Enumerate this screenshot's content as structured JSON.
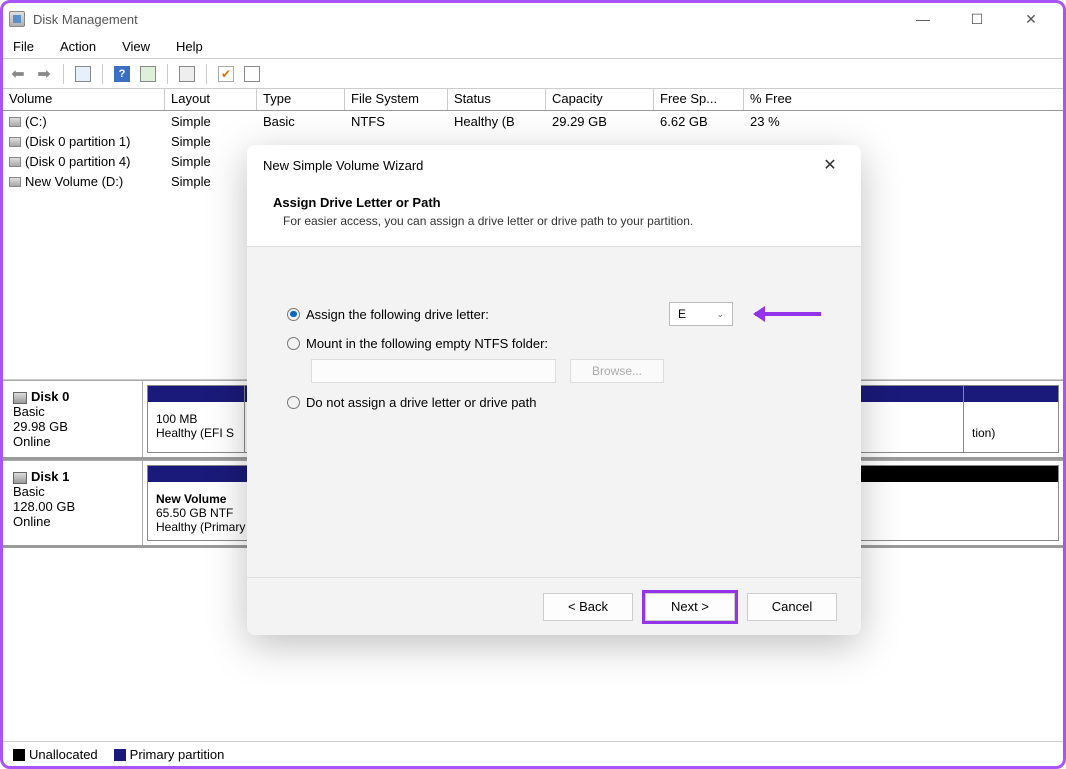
{
  "title": "Disk Management",
  "menus": {
    "file": "File",
    "action": "Action",
    "view": "View",
    "help": "Help"
  },
  "columns": {
    "volume": "Volume",
    "layout": "Layout",
    "type": "Type",
    "fs": "File System",
    "status": "Status",
    "capacity": "Capacity",
    "free": "Free Sp...",
    "pct": "% Free"
  },
  "volumes": [
    {
      "name": "(C:)",
      "layout": "Simple",
      "type": "Basic",
      "fs": "NTFS",
      "status": "Healthy (B",
      "capacity": "29.29 GB",
      "free": "6.62 GB",
      "pct": "23 %"
    },
    {
      "name": "(Disk 0 partition 1)",
      "layout": "Simple",
      "type": "",
      "fs": "",
      "status": "",
      "capacity": "",
      "free": "",
      "pct": ""
    },
    {
      "name": "(Disk 0 partition 4)",
      "layout": "Simple",
      "type": "",
      "fs": "",
      "status": "",
      "capacity": "",
      "free": "",
      "pct": ""
    },
    {
      "name": "New Volume (D:)",
      "layout": "Simple",
      "type": "",
      "fs": "",
      "status": "",
      "capacity": "",
      "free": "",
      "pct": ""
    }
  ],
  "disk0": {
    "name": "Disk 0",
    "type": "Basic",
    "size": "29.98 GB",
    "status": "Online",
    "part1": {
      "size": "100 MB",
      "status": "Healthy (EFI S"
    },
    "part_tail": "tion)"
  },
  "disk1": {
    "name": "Disk 1",
    "type": "Basic",
    "size": "128.00 GB",
    "status": "Online",
    "vol": {
      "name": "New Volume",
      "line2": "65.50 GB NTF",
      "line3": "Healthy (Primary Partition)"
    },
    "unalloc": "Unallocated"
  },
  "legend": {
    "unalloc": "Unallocated",
    "primary": "Primary partition"
  },
  "dialog": {
    "title": "New Simple Volume Wizard",
    "h1": "Assign Drive Letter or Path",
    "sub": "For easier access, you can assign a drive letter or drive path to your partition.",
    "opt1": "Assign the following drive letter:",
    "letter": "E",
    "opt2": "Mount in the following empty NTFS folder:",
    "browse": "Browse...",
    "opt3": "Do not assign a drive letter or drive path",
    "back": "< Back",
    "next": "Next >",
    "cancel": "Cancel"
  }
}
